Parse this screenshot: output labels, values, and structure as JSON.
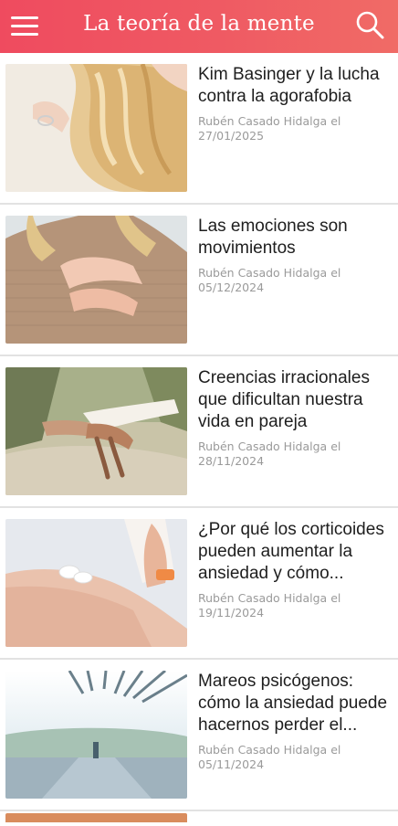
{
  "header": {
    "title": "La teoría de la mente",
    "menu_icon": "hamburger-menu-icon",
    "search_icon": "search-icon",
    "color": "#ef5060"
  },
  "articles": [
    {
      "title": "Kim Basinger y la lucha contra la agorafobia",
      "author": "Rubén Casado Hidalga el",
      "date": "27/01/2025"
    },
    {
      "title": "Las emociones son movimientos",
      "author": "Rubén Casado Hidalga el",
      "date": "05/12/2024"
    },
    {
      "title": "Creencias irracionales que dificultan nuestra vida en pareja",
      "author": "Rubén Casado Hidalga el",
      "date": "28/11/2024"
    },
    {
      "title": "¿Por qué los corticoides pueden aumentar la ansiedad y cómo...",
      "author": "Rubén Casado Hidalga el",
      "date": "19/11/2024"
    },
    {
      "title": "Mareos psicógenos: cómo la ansiedad puede hacernos perder el...",
      "author": "Rubén Casado Hidalga el",
      "date": "05/11/2024"
    }
  ]
}
